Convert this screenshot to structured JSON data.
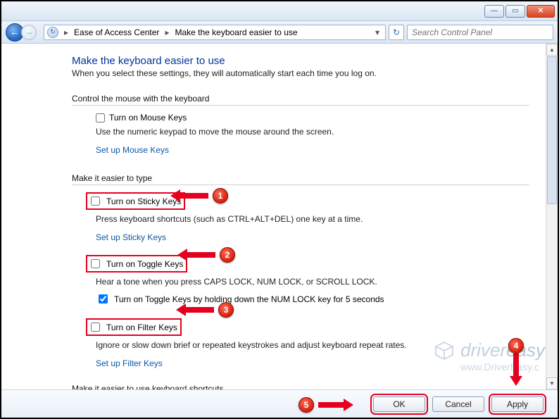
{
  "titlebar": {
    "min_glyph": "—",
    "max_glyph": "▭",
    "close_glyph": "✕"
  },
  "nav": {
    "back_glyph": "←",
    "fwd_glyph": "→",
    "icon_glyph": "↻",
    "crumb1": "Ease of Access Center",
    "crumb2": "Make the keyboard easier to use",
    "sep": "▸",
    "dd_glyph": "▾",
    "refresh_glyph": "↻",
    "search_placeholder": "Search Control Panel"
  },
  "page": {
    "title": "Make the keyboard easier to use",
    "subtitle": "When you select these settings, they will automatically start each time you log on."
  },
  "mouse": {
    "section": "Control the mouse with the keyboard",
    "opt_label": "Turn on Mouse Keys",
    "opt_desc": "Use the numeric keypad to move the mouse around the screen.",
    "link": "Set up Mouse Keys"
  },
  "type": {
    "section": "Make it easier to type",
    "sticky_label": "Turn on Sticky Keys",
    "sticky_desc": "Press keyboard shortcuts (such as CTRL+ALT+DEL) one key at a time.",
    "sticky_link": "Set up Sticky Keys",
    "toggle_label": "Turn on Toggle Keys",
    "toggle_desc": "Hear a tone when you press CAPS LOCK, NUM LOCK, or SCROLL LOCK.",
    "toggle_sub": "Turn on Toggle Keys by holding down the NUM LOCK key for 5 seconds",
    "filter_label": "Turn on Filter Keys",
    "filter_desc": "Ignore or slow down brief or repeated keystrokes and adjust keyboard repeat rates.",
    "filter_link": "Set up Filter Keys"
  },
  "shortcuts": {
    "section": "Make it easier to use keyboard shortcuts"
  },
  "footer": {
    "ok": "OK",
    "cancel": "Cancel",
    "apply": "Apply"
  },
  "watermark": {
    "main1": "driver",
    "main2": "easy",
    "sub": "www.DriverEasy.c"
  },
  "badges": {
    "b1": "1",
    "b2": "2",
    "b3": "3",
    "b4": "4",
    "b5": "5"
  },
  "scroll": {
    "up": "▲",
    "down": "▼"
  }
}
